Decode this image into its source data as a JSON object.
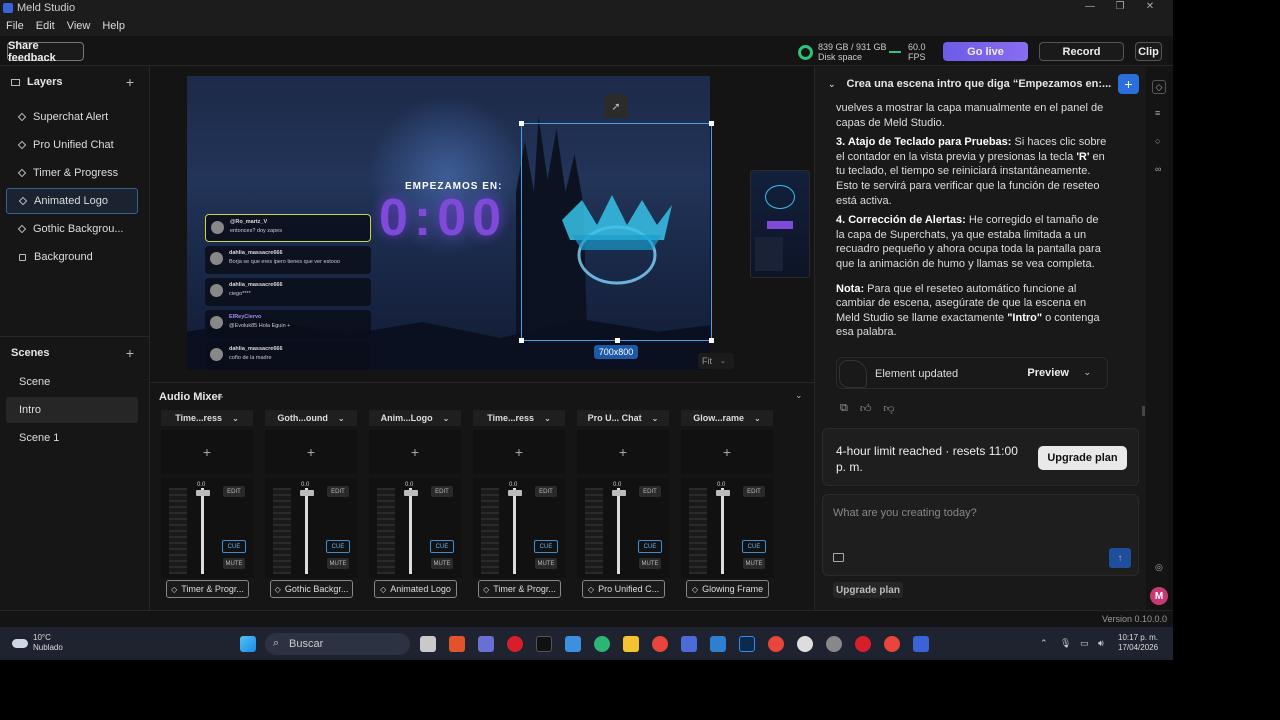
{
  "window": {
    "title": "Meld Studio",
    "controls": [
      "—",
      "❐",
      "✕"
    ]
  },
  "menu": [
    "File",
    "Edit",
    "View",
    "Help"
  ],
  "toolbar": {
    "share_feedback": "Share feedback",
    "disk_value": "839 GB / 931 GB",
    "disk_label": "Disk space",
    "fps_value": "60.0",
    "fps_label": "FPS",
    "go_live": "Go live",
    "record": "Record",
    "clip": "Clip"
  },
  "layers": {
    "title": "Layers",
    "items": [
      {
        "label": "Superchat Alert",
        "icon": "diamond-icon"
      },
      {
        "label": "Pro Unified Chat",
        "icon": "diamond-icon"
      },
      {
        "label": "Timer & Progress",
        "icon": "diamond-icon"
      },
      {
        "label": "Animated Logo",
        "icon": "diamond-icon"
      },
      {
        "label": "Gothic Backgrou...",
        "icon": "diamond-icon"
      },
      {
        "label": "Background",
        "icon": "square-icon"
      }
    ]
  },
  "scenes": {
    "title": "Scenes",
    "items": [
      "Scene",
      "Intro",
      "Scene 1"
    ]
  },
  "preview": {
    "heading": "EMPEZAMOS EN:",
    "timer": "0:00",
    "dimension_tag": "700x800",
    "fit_label": "Fit",
    "chat": [
      {
        "name": "@Ro_martz_V",
        "text": "entonces? doy zapes"
      },
      {
        "name": "dahlia_massacre666",
        "text": "Borja se que eres ipero tienes que ver estooo"
      },
      {
        "name": "dahlia_massacre666",
        "text": "ciego****"
      },
      {
        "name": "ElReyCiervo",
        "text": "@Evoluk85 Hola Eguin +"
      },
      {
        "name": "dahlia_massacre666",
        "text": "coño de la madre"
      }
    ]
  },
  "mixer": {
    "title": "Audio Mixer",
    "strips": [
      {
        "head": "Time...ress",
        "source": "Timer & Progr..."
      },
      {
        "head": "Goth...ound",
        "source": "Gothic Backgr..."
      },
      {
        "head": "Anim...Logo",
        "source": "Animated Logo"
      },
      {
        "head": "Time...ress",
        "source": "Timer & Progr..."
      },
      {
        "head": "Pro U... Chat",
        "source": "Pro Unified C..."
      },
      {
        "head": "Glow...rame",
        "source": "Glowing Frame"
      }
    ],
    "level": "0.0",
    "edit": "EDIT",
    "cue": "CUE",
    "mute": "MUTE"
  },
  "assistant": {
    "title": "Crea una escena intro que diga “Empezamos en:...",
    "para0": "vuelves a mostrar la capa manualmente en el panel de capas de Meld Studio.",
    "p3_bold": "3. Atajo de Teclado para Pruebas:",
    "p3_text": " Si haces clic sobre el contador en la vista previa y presionas la tecla ",
    "p3_key": "'R'",
    "p3_text2": " en tu teclado, el tiempo se reiniciará instantáneamente. Esto te servirá para verificar que la función de reseteo está activa.",
    "p4_bold": "4. Corrección de Alertas:",
    "p4_text": " He corregido el tamaño de la capa de Superchats, ya que estaba limitada a un recuadro pequeño y ahora ocupa toda la pantalla para que la animación de humo y llamas se vea completa.",
    "note_bold": "Nota:",
    "note_text": " Para que el reseteo automático funcione al cambiar de escena, asegúrate de que la escena en Meld Studio se llame exactamente ",
    "note_intro": "\"Intro\"",
    "note_text2": " o contenga esa palabra.",
    "element_updated": "Element updated",
    "preview_btn": "Preview",
    "limit_text": "4-hour limit reached · resets 11:00 p. m.",
    "upgrade_plan": "Upgrade plan",
    "input_placeholder": "What are you creating today?",
    "upgrade_plan_small": "Upgrade plan",
    "avatar_letter": "M"
  },
  "status": {
    "version": "Version 0.10.0.0"
  },
  "taskbar": {
    "temp": "10°C",
    "weather": "Nublado",
    "search": "Buscar",
    "time": "10:17 p. m.",
    "date": "17/04/2026"
  },
  "colors": {
    "accent": "#6c5ce7",
    "selection": "#4aa0e6",
    "timer": "#7e4bd9",
    "brand_blue": "#2b6fde"
  }
}
